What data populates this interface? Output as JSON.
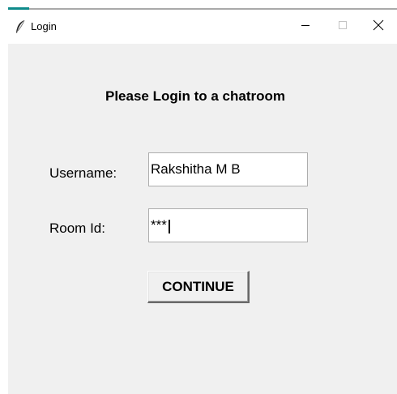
{
  "window": {
    "title": "Login",
    "icon": "feather-icon",
    "controls": [
      "minimize-icon",
      "maximize-icon",
      "close-icon"
    ]
  },
  "form": {
    "heading": "Please Login to a chatroom",
    "username_label": "Username:",
    "username_value": "Rakshitha M B",
    "room_label": "Room Id:",
    "room_value": "***",
    "continue_label": "CONTINUE"
  },
  "colors": {
    "window_bg": "#f0f0f0",
    "titlebar_bg": "#ffffff",
    "accent": "#0e8a8a",
    "field_border": "#adadad"
  }
}
